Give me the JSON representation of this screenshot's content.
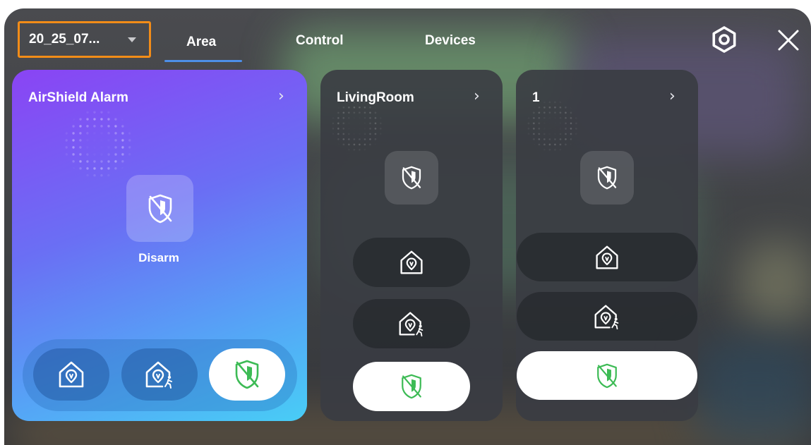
{
  "header": {
    "area_selector": "20_25_07...",
    "tabs": [
      {
        "label": "Area",
        "active": true
      },
      {
        "label": "Control",
        "active": false
      },
      {
        "label": "Devices",
        "active": false
      }
    ],
    "icons": {
      "settings": "gear-icon",
      "close": "close-icon"
    }
  },
  "areas": [
    {
      "name": "AirShield Alarm",
      "status": "Disarm",
      "active_mode": "disarm"
    },
    {
      "name": "LivingRoom",
      "status": "",
      "active_mode": "disarm"
    },
    {
      "name": "1",
      "status": "",
      "active_mode": "disarm"
    }
  ],
  "modes": [
    {
      "key": "home",
      "icon": "home-arm-icon"
    },
    {
      "key": "stay",
      "icon": "stay-arm-icon"
    },
    {
      "key": "disarm",
      "icon": "disarm-shield-icon"
    }
  ],
  "colors": {
    "highlight_border": "#f28c18",
    "tab_underline": "#4d8fe8",
    "disarm_green": "#3dbb55",
    "card_gradient_start": "#8a44f4",
    "card_gradient_end": "#48cdf6"
  }
}
